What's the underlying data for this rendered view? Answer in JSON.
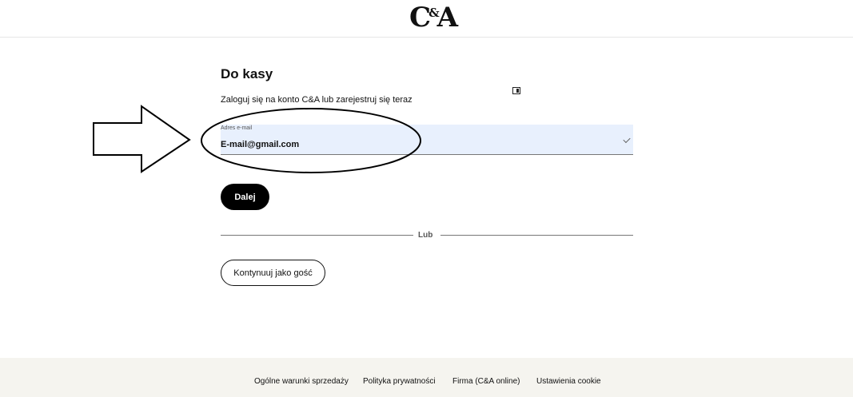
{
  "header": {
    "logo_left": "C",
    "logo_amp": "&",
    "logo_right": "A"
  },
  "main": {
    "title": "Do kasy",
    "subtitle": "Zaloguj się na konto C&A lub zarejestruj się teraz",
    "email": {
      "label": "Adres e-mail",
      "value": "E-mail@gmail.com"
    },
    "next_button": "Dalej",
    "divider_text": "Lub",
    "guest_button": "Kontynuuj jako gość"
  },
  "footer": {
    "links": [
      "Ogólne warunki sprzedaży",
      "Polityka prywatności",
      "Firma (C&A online)",
      "Ustawienia cookie"
    ]
  },
  "colors": {
    "input_background": "#e8f0fd",
    "primary_button": "#000000",
    "footer_background": "#f5f4ef",
    "annotation": "#000000"
  },
  "icons": [
    "card-icon",
    "check-icon",
    "arrow-annotation"
  ]
}
